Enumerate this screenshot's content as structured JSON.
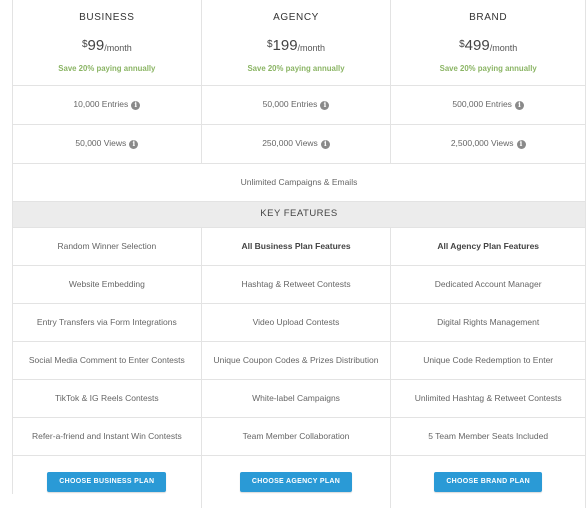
{
  "plans": [
    {
      "name": "BUSINESS",
      "currency": "$",
      "amount": "99",
      "period": "/month",
      "save": "Save 20% paying annually",
      "entries": "10,000 Entries",
      "views": "50,000 Views",
      "button": "CHOOSE BUSINESS PLAN"
    },
    {
      "name": "AGENCY",
      "currency": "$",
      "amount": "199",
      "period": "/month",
      "save": "Save 20% paying annually",
      "entries": "50,000 Entries",
      "views": "250,000 Views",
      "button": "CHOOSE AGENCY PLAN"
    },
    {
      "name": "BRAND",
      "currency": "$",
      "amount": "499",
      "period": "/month",
      "save": "Save 20% paying annually",
      "entries": "500,000 Entries",
      "views": "2,500,000 Views",
      "button": "CHOOSE BRAND PLAN"
    }
  ],
  "info_glyph": "i",
  "unlimited": "Unlimited Campaigns & Emails",
  "key_features_heading": "KEY FEATURES",
  "features": [
    [
      "Random Winner Selection",
      "All Business Plan Features",
      "All Agency Plan Features"
    ],
    [
      "Website Embedding",
      "Hashtag & Retweet Contests",
      "Dedicated Account Manager"
    ],
    [
      "Entry Transfers via Form Integrations",
      "Video Upload Contests",
      "Digital Rights Management"
    ],
    [
      "Social Media Comment to Enter Contests",
      "Unique Coupon Codes & Prizes Distribution",
      "Unique Code Redemption to Enter"
    ],
    [
      "TikTok & IG Reels Contests",
      "White-label Campaigns",
      "Unlimited Hashtag & Retweet Contests"
    ],
    [
      "Refer-a-friend and Instant Win Contests",
      "Team Member Collaboration",
      "5 Team Member Seats Included"
    ]
  ],
  "colors": {
    "accent_button": "#2a9ad6",
    "save_text": "#8bb565",
    "section_bg": "#ececec"
  }
}
